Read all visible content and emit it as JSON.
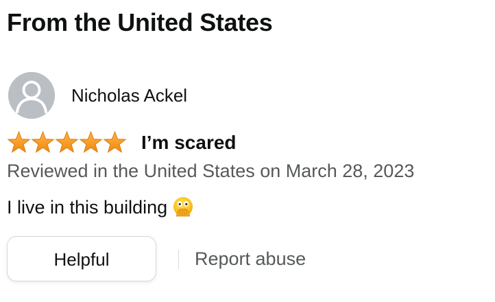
{
  "section": {
    "title": "From the United States"
  },
  "review": {
    "reviewer_name": "Nicholas Ackel",
    "avatar_icon": "default-user-avatar-icon",
    "rating": 5,
    "rating_max": 5,
    "star_color": "#ff9900",
    "title": "I’m scared",
    "date_line": "Reviewed in the United States on March 28, 2023",
    "body_text": "I live in this building",
    "body_emoji": "face-with-open-eyes-and-hand-over-mouth-icon"
  },
  "actions": {
    "helpful_label": "Helpful",
    "report_label": "Report abuse"
  },
  "colors": {
    "text_primary": "#0f1111",
    "text_secondary": "#565959",
    "button_border": "#d5d9d9",
    "avatar_bg": "#b9bfc4"
  }
}
